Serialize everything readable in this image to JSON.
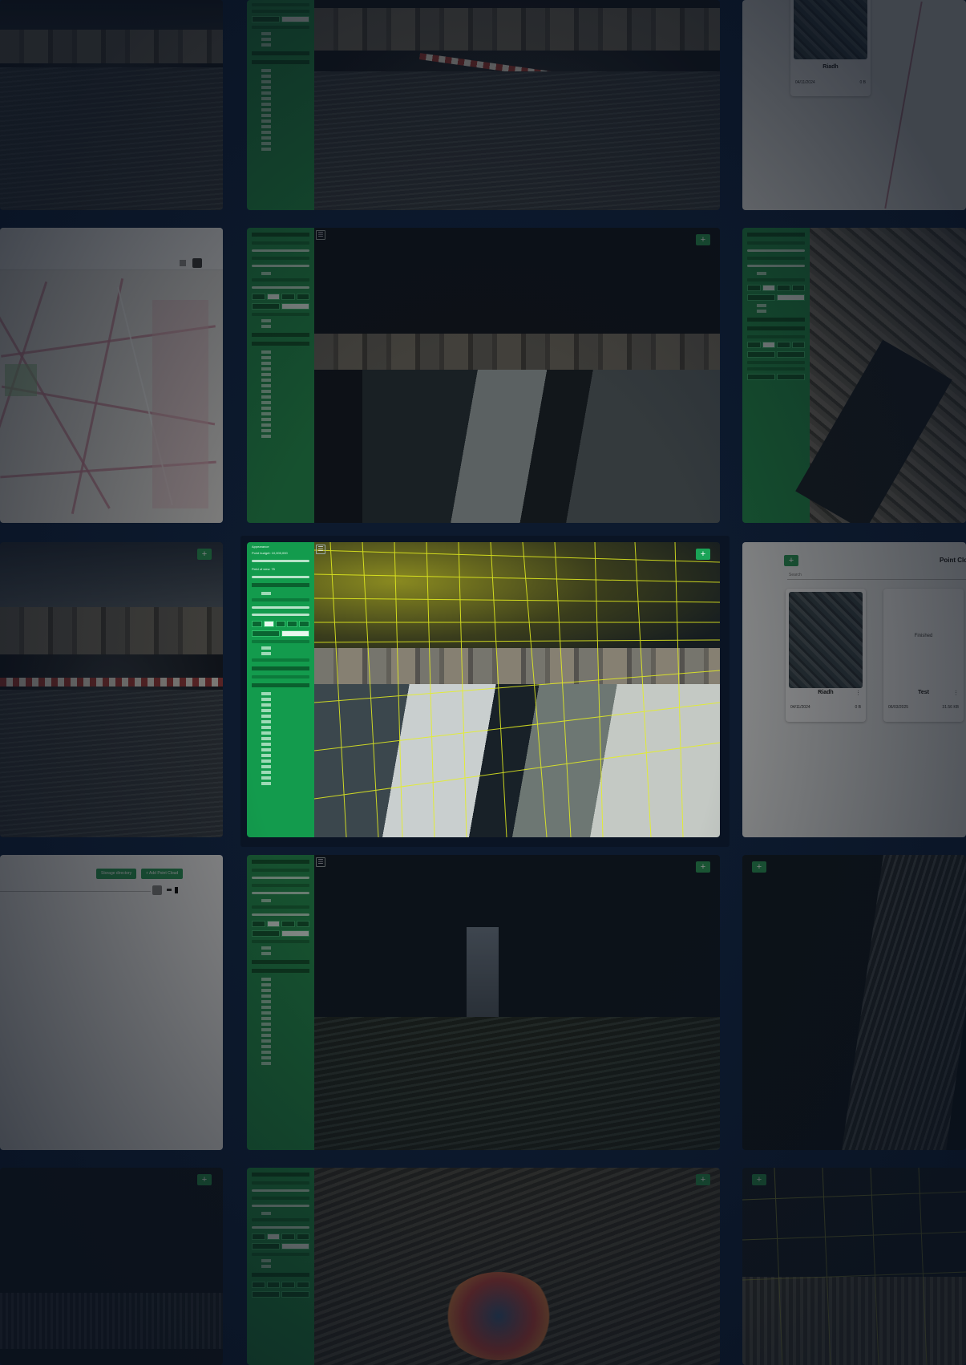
{
  "viewer": {
    "add_label": "+",
    "menu_glyph": "☰",
    "panel_title": "Appearance",
    "point_budget": "Point budget: 10,000,000",
    "fov": "Field of view: 75",
    "quality_options": [
      "Standard",
      "High Quality"
    ],
    "background_options": [
      "Skybox",
      "Gradient",
      "Black",
      "White",
      "None"
    ]
  },
  "gallery": {
    "title": "Point Clo",
    "search_placeholder": "Search",
    "cards": [
      {
        "name": "Riadh",
        "date": "04/11/2024",
        "size": "0 B",
        "status": ""
      },
      {
        "name": "Test",
        "date": "06/03/2025",
        "size": "31.56 KB",
        "status": "Finished"
      }
    ],
    "top_card": {
      "name": "Riadh",
      "date": "04/11/2024",
      "size": "0 B"
    }
  },
  "actions": {
    "manage_label": "Storage directory",
    "add_label": "+ Add Point Cloud"
  },
  "colors": {
    "panel_green": "#139b4d",
    "accent": "#1aa357",
    "grid_yellow": "#e6f020",
    "background": "#0d1a2e"
  }
}
